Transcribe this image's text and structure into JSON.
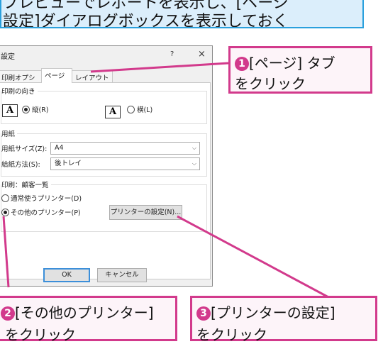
{
  "banner": {
    "line1": "プレビューでレポートを表示し、[ページ",
    "line2": "設定]ダイアログボックスを表示しておく"
  },
  "dialog": {
    "title": "設定",
    "help": "?",
    "close": "×",
    "tabs": [
      {
        "label": "印刷オプション"
      },
      {
        "label": "ページ"
      },
      {
        "label": "レイアウト"
      }
    ],
    "orientation": {
      "label": "印刷の向き",
      "icon_glyph": "A",
      "portrait": "縦(R)",
      "landscape": "横(L)",
      "selected": "portrait"
    },
    "paper": {
      "label": "用紙",
      "size_label": "用紙サイズ(Z):",
      "size_value": "A4",
      "source_label": "給紙方法(S):",
      "source_value": "後トレイ"
    },
    "printer": {
      "label": "印刷：顧客一覧",
      "default_option": "通常使うプリンター(D)",
      "other_option": "その他のプリンター(P)",
      "selected": "other",
      "setup_button": "プリンターの設定(N)..."
    },
    "ok": "OK",
    "cancel": "キャンセル"
  },
  "callouts": [
    {
      "num": "1",
      "line1": "[ページ] タブ",
      "line2": "をクリック"
    },
    {
      "num": "2",
      "line1": "[その他のプリンター]",
      "line2": "をクリック"
    },
    {
      "num": "3",
      "line1": "[プリンターの設定]",
      "line2": "をクリック"
    }
  ],
  "colors": {
    "accent_magenta": "#d23a8c",
    "banner_blue": "#2aa0dd",
    "banner_fill": "#dbeefb"
  }
}
